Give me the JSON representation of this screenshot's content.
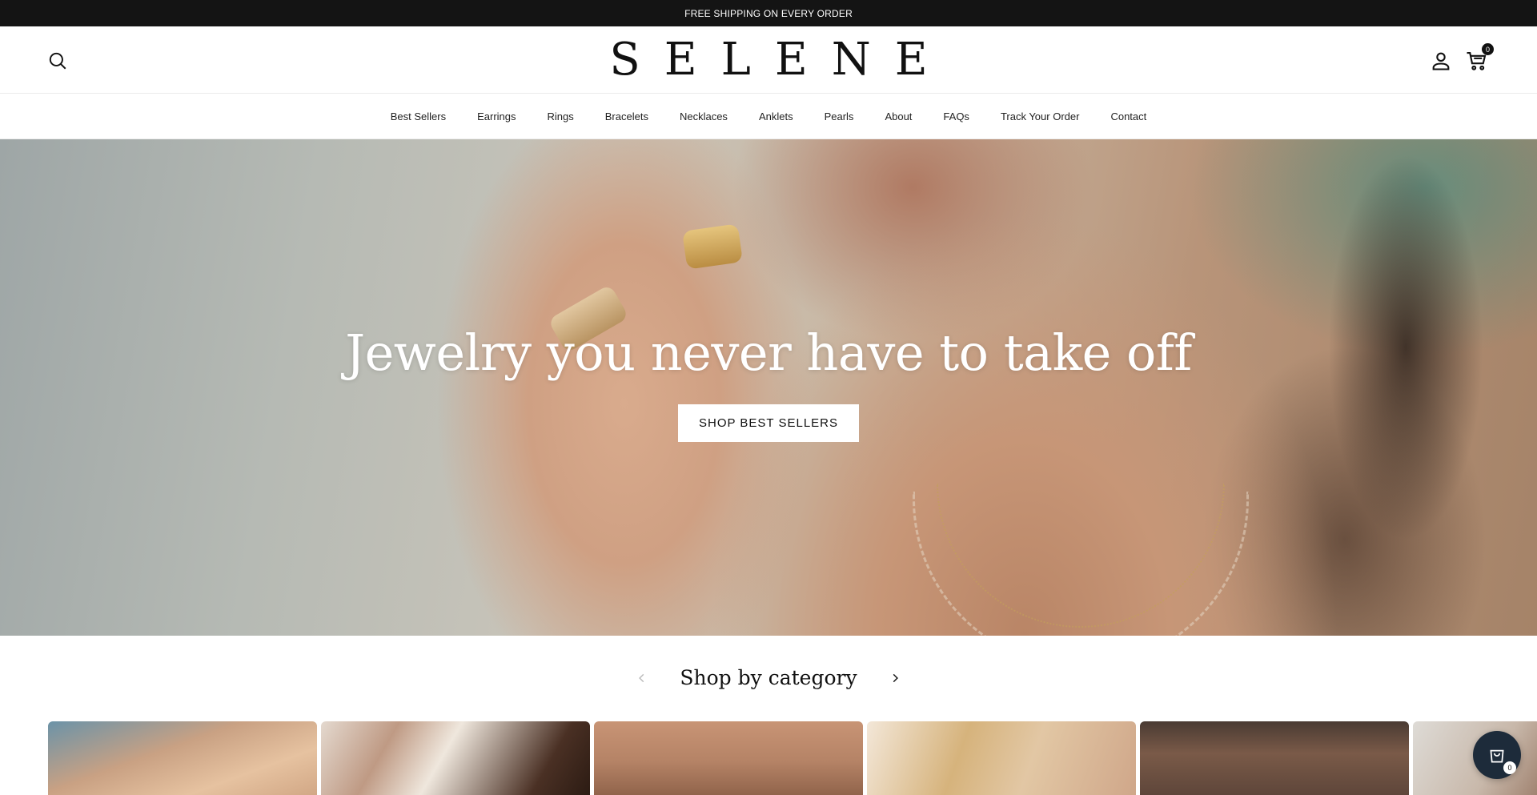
{
  "announcement": {
    "text": "FREE SHIPPING ON EVERY ORDER"
  },
  "header": {
    "logo": "SELENE",
    "search_icon": "search-icon",
    "account_icon": "user-icon",
    "cart_icon": "cart-icon",
    "cart_count": "0"
  },
  "nav": {
    "items": [
      {
        "label": "Best Sellers"
      },
      {
        "label": "Earrings"
      },
      {
        "label": "Rings"
      },
      {
        "label": "Bracelets"
      },
      {
        "label": "Necklaces"
      },
      {
        "label": "Anklets"
      },
      {
        "label": "Pearls"
      },
      {
        "label": "About"
      },
      {
        "label": "FAQs"
      },
      {
        "label": "Track Your Order"
      },
      {
        "label": "Contact"
      }
    ]
  },
  "hero": {
    "title": "Jewelry you never have to take off",
    "button_label": "SHOP BEST SELLERS"
  },
  "categories": {
    "title": "Shop by category",
    "prev_icon": "chevron-left-icon",
    "next_icon": "chevron-right-icon"
  },
  "cart_fab": {
    "icon": "shopping-bag-icon",
    "count": "0"
  },
  "colors": {
    "announcement_bg": "#141414",
    "fab_bg": "#1d2b3a",
    "text": "#111111"
  }
}
